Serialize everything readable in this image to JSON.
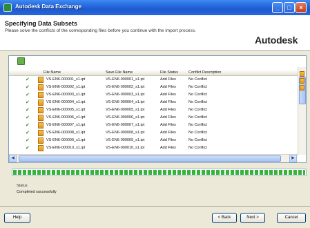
{
  "window": {
    "title": "Autodesk Data Exchange"
  },
  "header": {
    "title": "Specifying Data Subsets",
    "subtitle": "Please solve the conflicts of the corresponding files before you continue with the import process.",
    "brand": "Autodesk"
  },
  "grid": {
    "columns": [
      "File Name",
      "Save File Name",
      "File Status",
      "Conflict Description"
    ],
    "rows": [
      {
        "file": "VS-EN6-000001_s1.ipt",
        "save": "VS-EN6-000001_s1.ipt",
        "status": "Add Files",
        "conflict": "No Conflict"
      },
      {
        "file": "VS-EN6-000002_s1.ipt",
        "save": "VS-EN6-000002_s1.ipt",
        "status": "Add Files",
        "conflict": "No Conflict"
      },
      {
        "file": "VS-EN6-000003_s1.ipt",
        "save": "VS-EN6-000003_s1.ipt",
        "status": "Add Files",
        "conflict": "No Conflict"
      },
      {
        "file": "VS-EN6-000004_s1.ipt",
        "save": "VS-EN6-000004_s1.ipt",
        "status": "Add Files",
        "conflict": "No Conflict"
      },
      {
        "file": "VS-EN6-000005_s1.ipt",
        "save": "VS-EN6-000005_s1.ipt",
        "status": "Add Files",
        "conflict": "No Conflict"
      },
      {
        "file": "VS-EN6-000006_s1.ipt",
        "save": "VS-EN6-000006_s1.ipt",
        "status": "Add Files",
        "conflict": "No Conflict"
      },
      {
        "file": "VS-EN6-000007_s1.ipt",
        "save": "VS-EN6-000007_s1.ipt",
        "status": "Add Files",
        "conflict": "No Conflict"
      },
      {
        "file": "VS-EN6-000008_s1.ipt",
        "save": "VS-EN6-000008_s1.ipt",
        "status": "Add Files",
        "conflict": "No Conflict"
      },
      {
        "file": "VS-EN6-000009_s1.ipt",
        "save": "VS-EN6-000009_s1.ipt",
        "status": "Add Files",
        "conflict": "No Conflict"
      },
      {
        "file": "VS-EN6-000010_s1.ipt",
        "save": "VS-EN6-000010_s1.ipt",
        "status": "Add Files",
        "conflict": "No Conflict"
      }
    ]
  },
  "progress": {
    "fraction": 1.0
  },
  "status": {
    "label": "Status",
    "text": "Completed successfully"
  },
  "buttons": {
    "help": "Help",
    "back": "< Back",
    "next": "Next >",
    "cancel": "Cancel"
  },
  "colors": {
    "titlebar": "#1c5ad0",
    "progress": "#37b337",
    "file_icon": "#e2961d",
    "check": "#2f8a2a"
  }
}
